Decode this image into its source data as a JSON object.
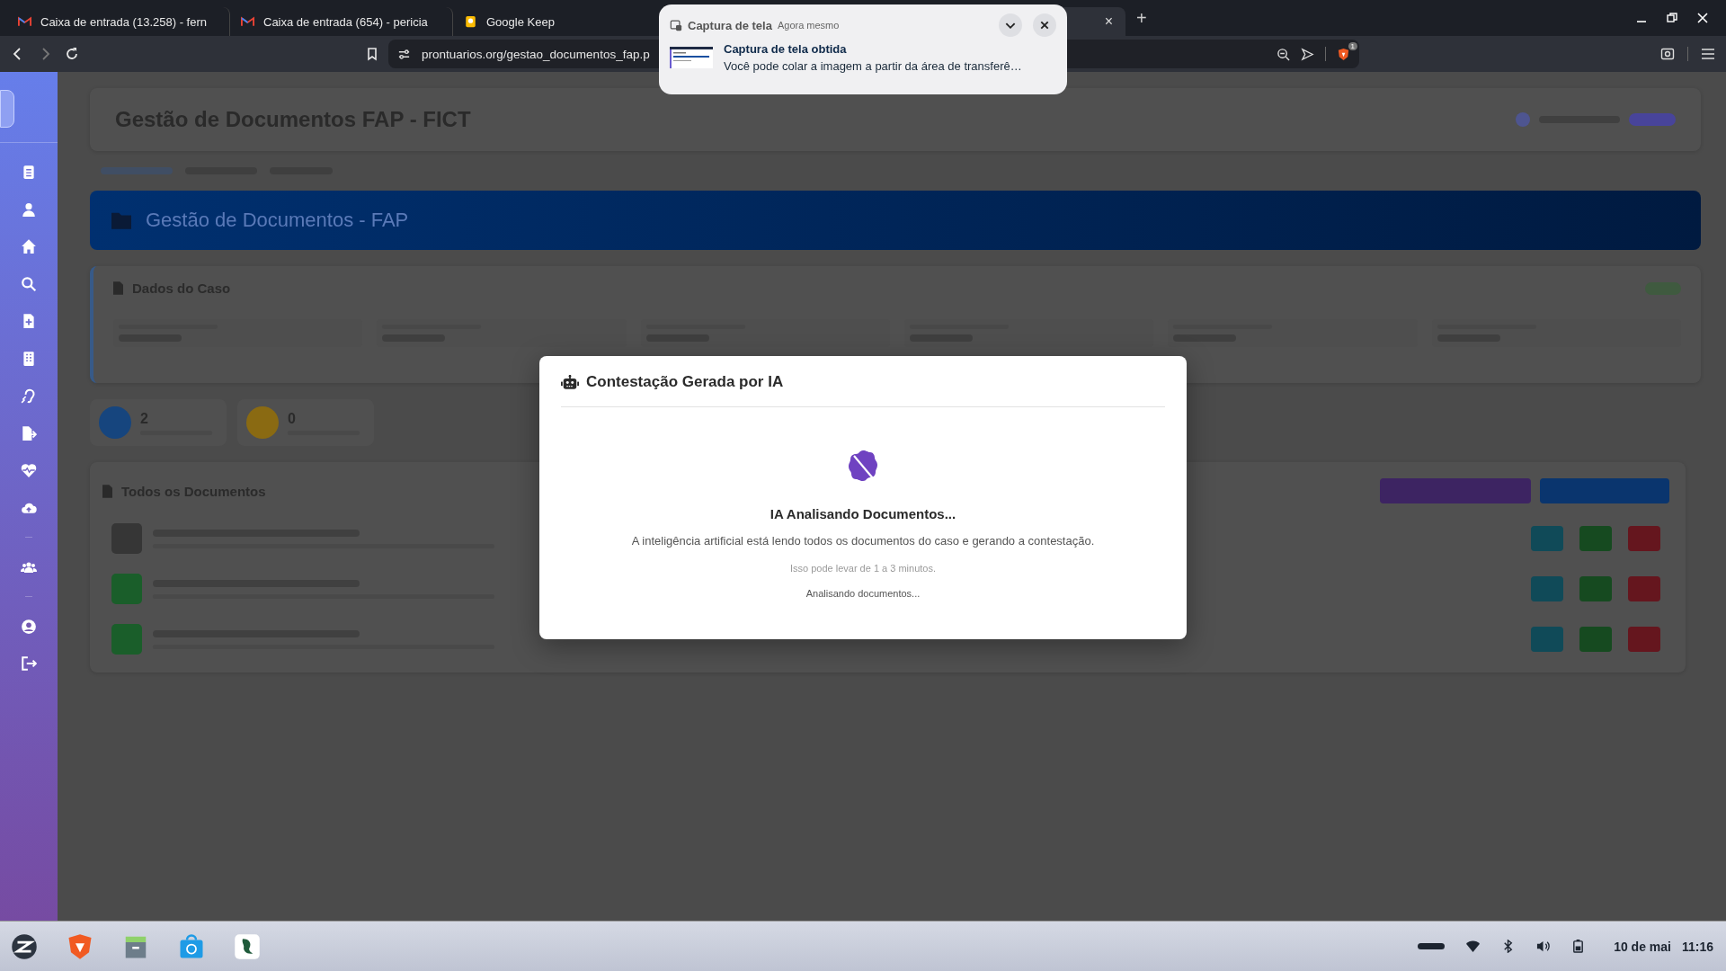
{
  "browser": {
    "tabs": [
      {
        "label": "Caixa de entrada (13.258) - fern",
        "kind": "gmail",
        "selected": false
      },
      {
        "label": "Caixa de entrada (654) - pericia",
        "kind": "gmail",
        "selected": false
      },
      {
        "label": "Google Keep",
        "kind": "keep",
        "selected": false
      },
      {
        "selected": true,
        "close": "×"
      }
    ],
    "new_tab": "+",
    "address": "prontuarios.org/gestao_documentos_fap.p",
    "extension_badge": "1"
  },
  "notification": {
    "app": "Captura de tela",
    "time": "Agora mesmo",
    "title": "Captura de tela obtida",
    "body": "Você pode colar a imagem a partir da área de transferê…"
  },
  "page": {
    "title": "Gestão de Documentos FAP - FICT",
    "banner": "Gestão de Documentos - FAP",
    "case_section": "Dados do Caso",
    "stats": [
      {
        "value": "2",
        "color": "#16457e"
      },
      {
        "value": "0",
        "color": "#8a6a12"
      }
    ],
    "documents_section": "Todos os Documentos",
    "documents": [
      {
        "color": "#363636"
      },
      {
        "color": "#1a5e2a"
      },
      {
        "color": "#1a5e2a"
      }
    ]
  },
  "modal": {
    "title": "Contestação Gerada por IA",
    "heading": "IA Analisando Documentos...",
    "description": "A inteligência artificial está lendo todos os documentos do caso e gerando a contestação.",
    "hint": "Isso pode levar de 1 a 3 minutos.",
    "status": "Analisando documentos..."
  },
  "taskbar": {
    "date": "10 de mai",
    "time": "11:16"
  }
}
